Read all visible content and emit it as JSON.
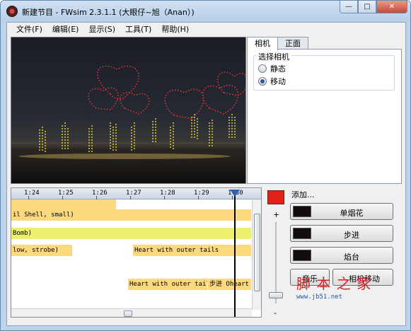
{
  "window": {
    "title": "新建节目 - FWsim 2.3.1.1 (大眼仔~旭（Anan）)",
    "controls": [
      "min-icon",
      "max-icon",
      "close-icon"
    ]
  },
  "menu": {
    "items": [
      "文件(F)",
      "编辑(E)",
      "显示(S)",
      "工具(T)",
      "帮助(H)"
    ]
  },
  "side_panel": {
    "tabs": [
      "相机",
      "正面"
    ],
    "active_tab": 0,
    "group_label": "选择相机",
    "options": [
      {
        "label": "静态",
        "selected": false
      },
      {
        "label": "移动",
        "selected": true
      }
    ]
  },
  "timeline": {
    "ticks": [
      "1:24",
      "1:25",
      "1:26",
      "1:27",
      "1:28",
      "1:29",
      "1:30"
    ],
    "rows": [
      {
        "lane": 0,
        "text": "",
        "color": "#fcd87e"
      },
      {
        "lane": 1,
        "text": "il Shell, small)",
        "color": "#fcd87e"
      },
      {
        "lane": 2,
        "text": "Bomb)",
        "color": "#ecf06b"
      },
      {
        "lane": 3,
        "text": "low, strobe)",
        "color": "#fcd87e"
      },
      {
        "lane": 3,
        "text": "Heart with outer tails",
        "color": "#fcd87e"
      },
      {
        "lane": 5,
        "text": "Heart with outer tails",
        "color": "#fcd87e"
      },
      {
        "lane": 5,
        "text": "步进  Oheart Bo",
        "color": "#fcd87e"
      }
    ]
  },
  "volume": {
    "plus": "+",
    "minus": "-",
    "color": "#e0201a",
    "level": 0.85
  },
  "add_panel": {
    "label": "添加...",
    "buttons": [
      "单烟花",
      "步进",
      "焰台"
    ],
    "small_buttons": [
      "音乐",
      "相机移动"
    ]
  },
  "watermark": {
    "text": "脚 本 之 家",
    "url": "www.jb51.net"
  }
}
